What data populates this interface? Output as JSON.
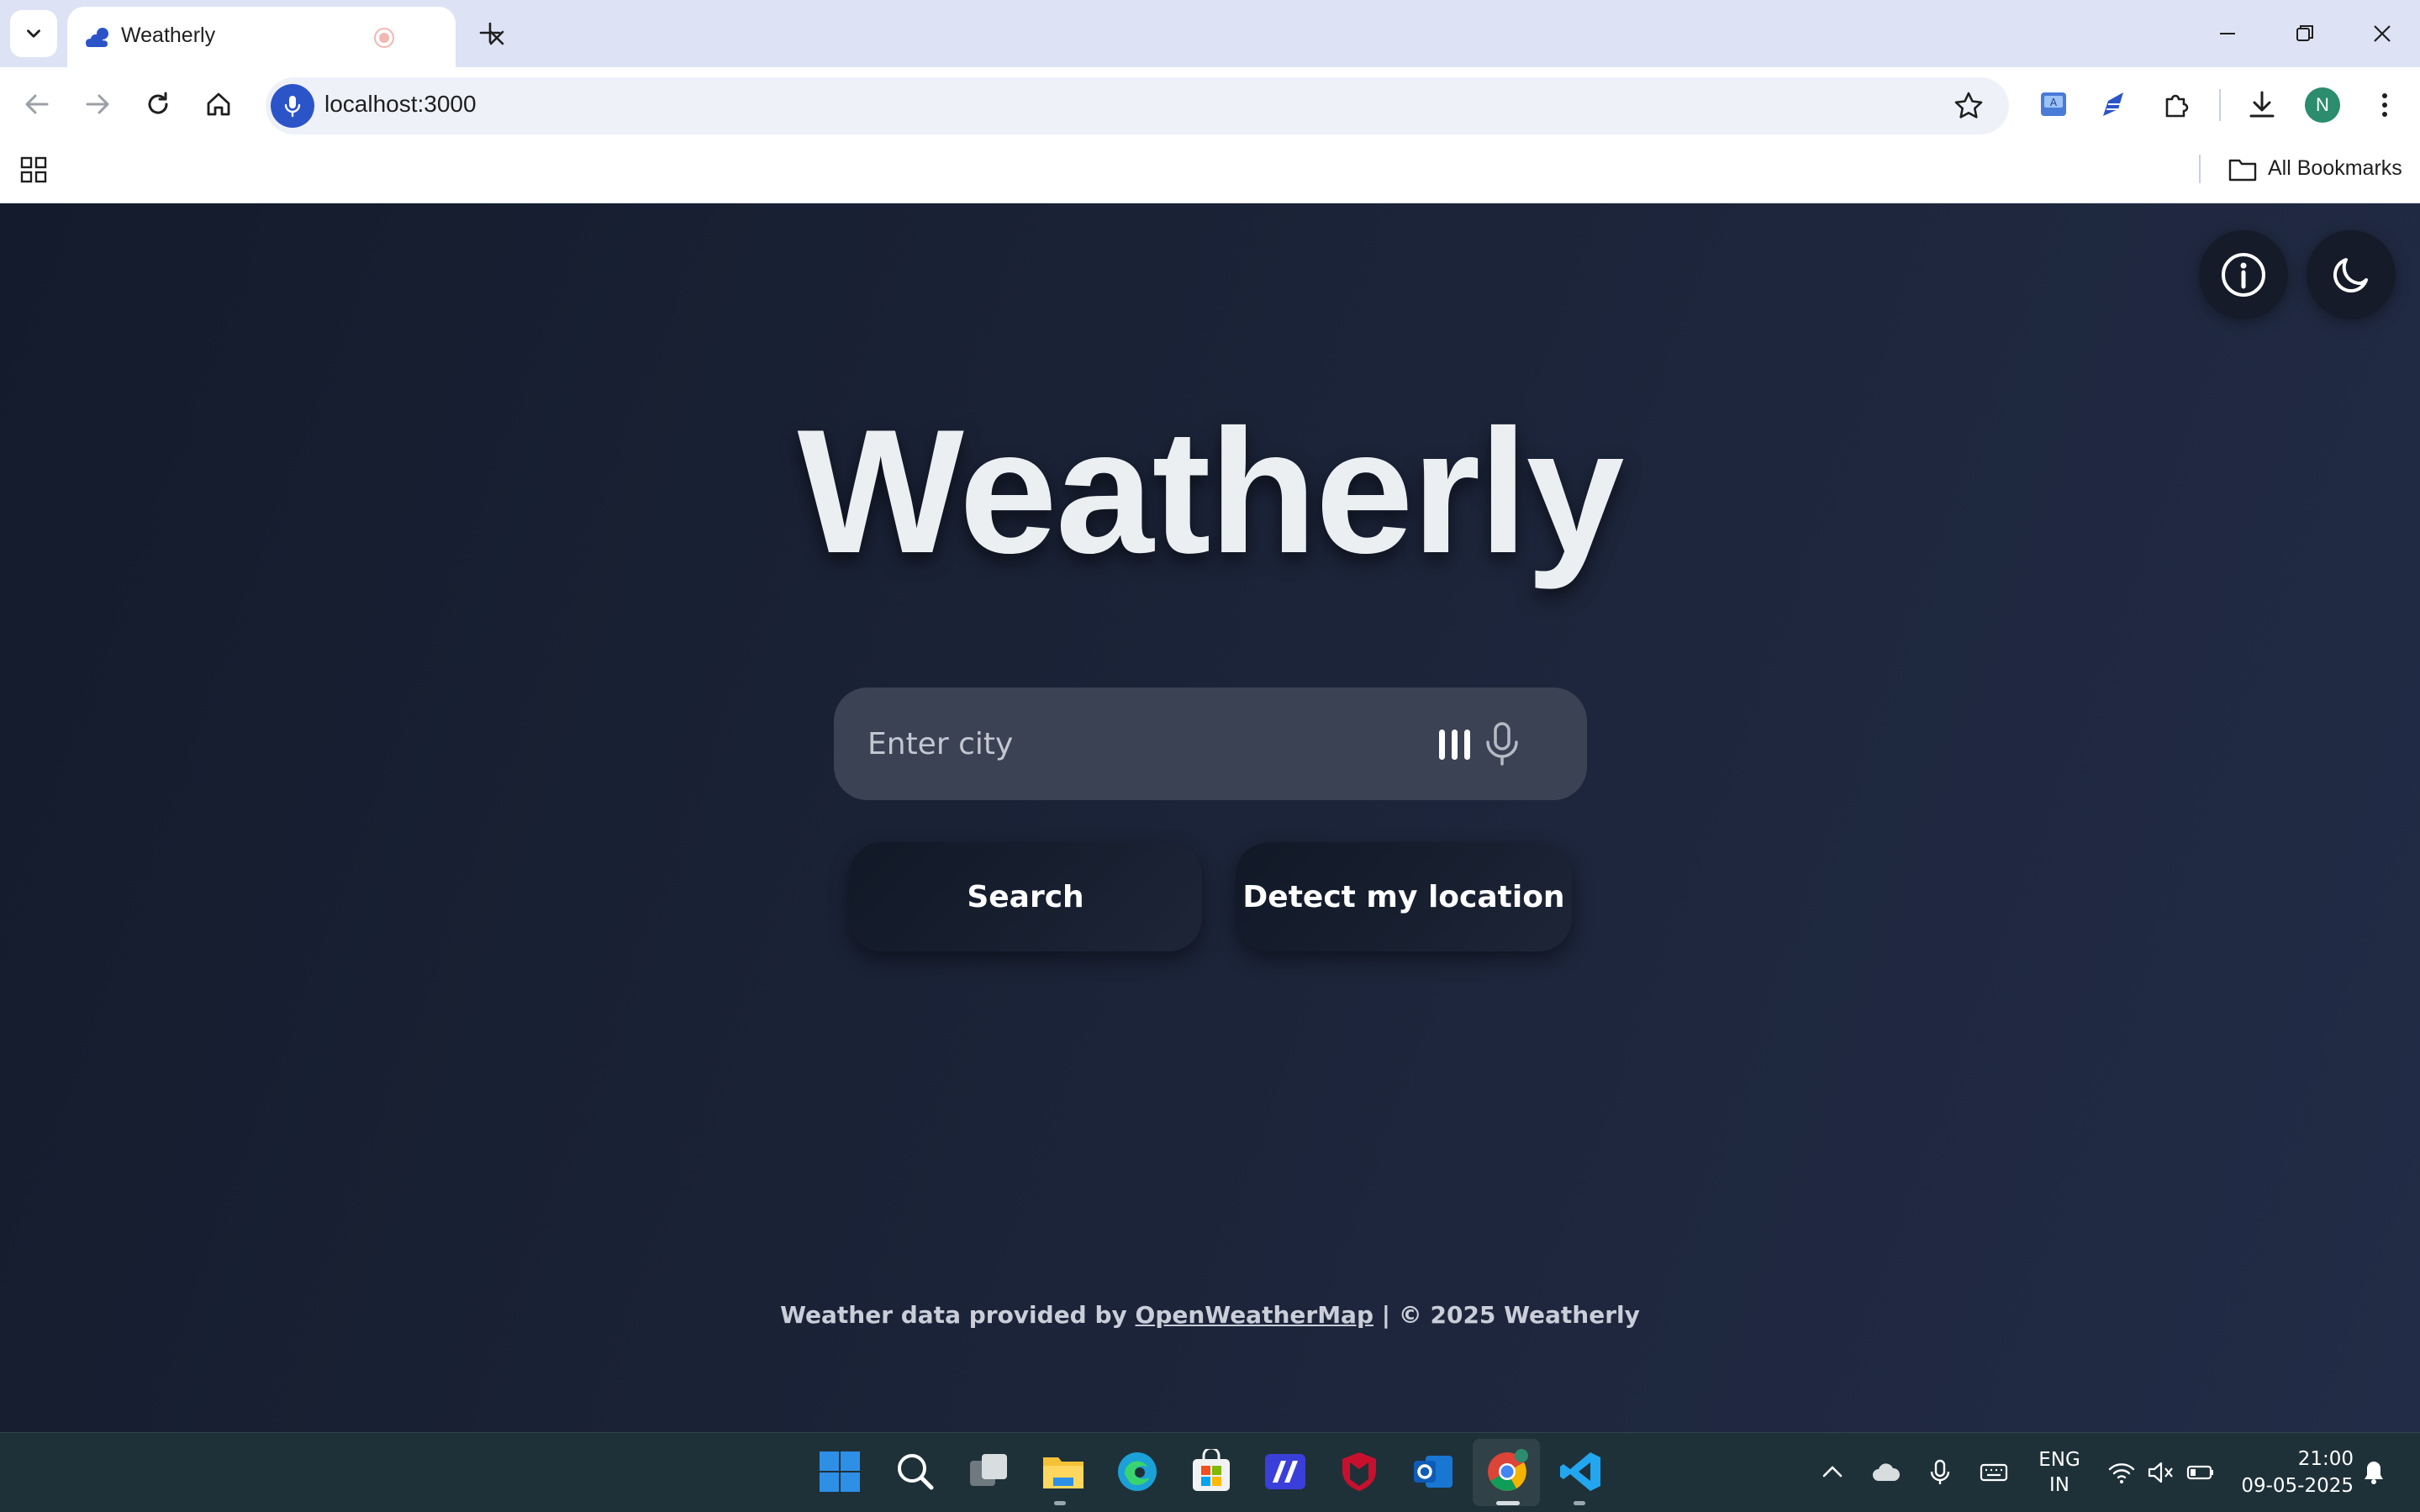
{
  "browser": {
    "tab_title": "Weatherly",
    "url": "localhost:3000",
    "bookmarks_label": "All Bookmarks",
    "profile_initial": "N"
  },
  "app": {
    "title": "Weatherly",
    "search_placeholder": "Enter city",
    "search_button": "Search",
    "detect_button": "Detect my location",
    "footer_prefix": "Weather data provided by",
    "footer_link": "OpenWeatherMap",
    "footer_suffix": "| © 2025 Weatherly"
  },
  "taskbar": {
    "language_line1": "ENG",
    "language_line2": "IN",
    "time": "21:00",
    "date": "09-05-2025"
  },
  "colors": {
    "page_bg": "#1a2236",
    "title_text": "#eceff1",
    "search_box_bg": "#3b4254",
    "button_bg": "#111826",
    "chrome_accent": "#2c54c9"
  }
}
